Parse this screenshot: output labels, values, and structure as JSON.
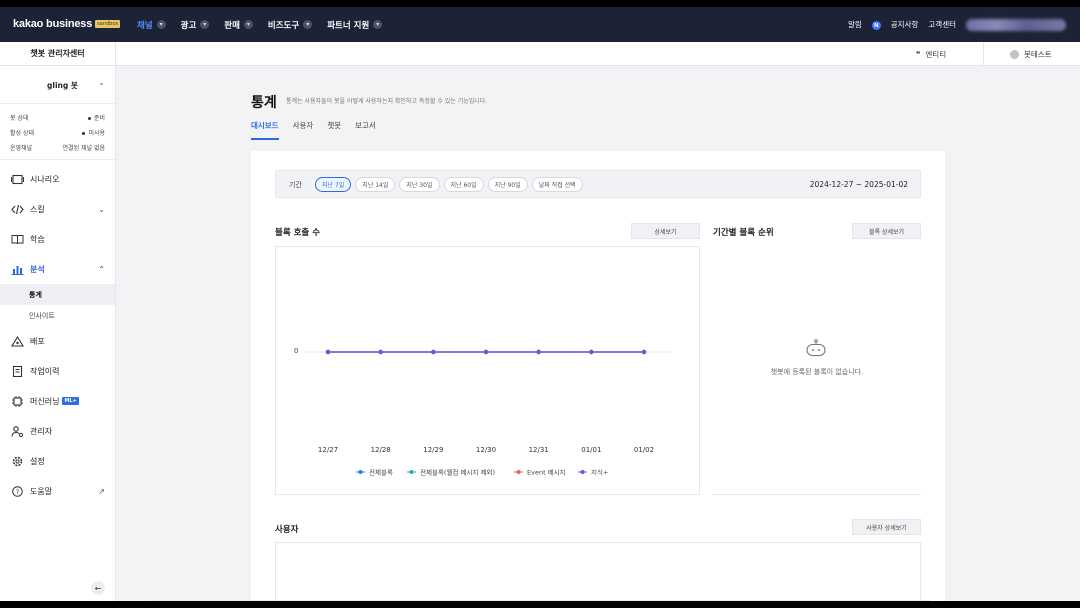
{
  "header": {
    "logo": "kakao business",
    "logo_badge": "sandbox",
    "nav": [
      {
        "label": "채널",
        "active": true
      },
      {
        "label": "광고",
        "active": false
      },
      {
        "label": "판매",
        "active": false
      },
      {
        "label": "비즈도구",
        "active": false
      },
      {
        "label": "파트너 지원",
        "active": false
      }
    ],
    "alarm": "알림",
    "alarm_badge": "N",
    "notice": "공지사항",
    "support": "고객센터"
  },
  "sidebar": {
    "title": "챗봇 관리자센터",
    "bot_name": "gling 봇",
    "status": [
      {
        "label": "봇 상태",
        "value": "준비"
      },
      {
        "label": "활성 상태",
        "value": "미사용"
      },
      {
        "label": "운영채널",
        "value": "연결된 채널 없음"
      }
    ],
    "menu": {
      "scenario": "시나리오",
      "skill": "스킬",
      "learning": "학습",
      "analysis": "분석",
      "stats": "통계",
      "insight": "인사이트",
      "deploy": "배포",
      "history": "작업이력",
      "ml": "머신러닝",
      "ml_badge": "ML+",
      "admin": "관리자",
      "settings": "설정",
      "help": "도움말"
    }
  },
  "subheader": {
    "entity": "엔티티",
    "bot_test": "봇테스트"
  },
  "page": {
    "title": "통계",
    "description": "통계는 사용자들이 봇을 어떻게 사용하는지 확인하고 측정할 수 있는 기능입니다.",
    "tabs": [
      {
        "label": "대시보드",
        "active": true
      },
      {
        "label": "사용자",
        "active": false
      },
      {
        "label": "챗봇",
        "active": false
      },
      {
        "label": "보고서",
        "active": false
      }
    ]
  },
  "filter": {
    "label": "기간",
    "options": [
      {
        "label": "지난 7일",
        "active": true
      },
      {
        "label": "지난 14일",
        "active": false
      },
      {
        "label": "지난 30일",
        "active": false
      },
      {
        "label": "지난 60일",
        "active": false
      },
      {
        "label": "지난 90일",
        "active": false
      },
      {
        "label": "날짜 직접 선택",
        "active": false
      }
    ],
    "date_range": "2024-12-27 ~ 2025-01-02"
  },
  "block_calls": {
    "title": "블록 호출 수",
    "detail_button": "상세보기"
  },
  "block_rank": {
    "title": "기간별 블록 순위",
    "detail_button": "블록 상세보기",
    "empty_text": "챗봇에 등록된 블록이 없습니다."
  },
  "users": {
    "title": "사용자",
    "detail_button": "사용자 상세보기"
  },
  "chart_data": {
    "type": "line",
    "categories": [
      "12/27",
      "12/28",
      "12/29",
      "12/30",
      "12/31",
      "01/01",
      "01/02"
    ],
    "y_ticks": [
      "0"
    ],
    "series": [
      {
        "name": "전체블록",
        "color": "#2f80d8",
        "values": [
          0,
          0,
          0,
          0,
          0,
          0,
          0
        ]
      },
      {
        "name": "전체블록(웰컴 메시지 제외)",
        "color": "#25b5a8",
        "values": [
          0,
          0,
          0,
          0,
          0,
          0,
          0
        ]
      },
      {
        "name": "Event 메시지",
        "color": "#e0606a",
        "values": [
          0,
          0,
          0,
          0,
          0,
          0,
          0
        ]
      },
      {
        "name": "지식+",
        "color": "#7b4fd6",
        "values": [
          0,
          0,
          0,
          0,
          0,
          0,
          0
        ]
      }
    ],
    "legend": "bottom"
  }
}
